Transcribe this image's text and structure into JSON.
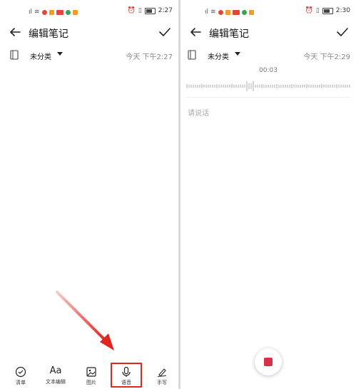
{
  "colors": {
    "accent_red": "#e0261f",
    "stop_red": "#d9304a",
    "status_orange": "#f59a23",
    "status_red": "#e2463a",
    "status_green": "#2fa84f"
  },
  "left": {
    "status_time": "2:27",
    "title": "编辑笔记",
    "category": "未分类",
    "timestamp": "今天 下午2:27",
    "toolbar": [
      {
        "icon": "checklist-icon",
        "label": "清单"
      },
      {
        "icon": "text-format-icon",
        "glyph": "Aa",
        "label": "文本编辑"
      },
      {
        "icon": "image-icon",
        "label": "图片"
      },
      {
        "icon": "microphone-icon",
        "label": "语音"
      },
      {
        "icon": "handwriting-icon",
        "label": "手写"
      }
    ]
  },
  "right": {
    "status_time": "2:30",
    "title": "编辑笔记",
    "category": "未分类",
    "timestamp": "今天 下午2:29",
    "recording_time": "00:03",
    "placeholder": "请说话",
    "stop_icon": "stop-icon"
  }
}
